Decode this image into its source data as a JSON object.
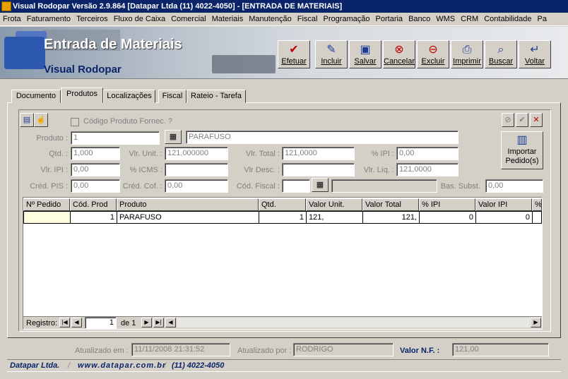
{
  "window": {
    "title": "Visual Rodopar Versão 2.9.864 [Datapar Ltda (11) 4022-4050]  - [ENTRADA DE MATERIAIS]"
  },
  "menu": [
    "Frota",
    "Faturamento",
    "Terceiros",
    "Fluxo de Caixa",
    "Comercial",
    "Materiais",
    "Manutenção",
    "Fiscal",
    "Programação",
    "Portaria",
    "Banco",
    "WMS",
    "CRM",
    "Contabilidade",
    "Pa"
  ],
  "banner": {
    "title": "Entrada de Materiais",
    "subtitle": "Visual Rodopar"
  },
  "toolbar": [
    {
      "label": "Efetuar",
      "icon": "check-icon"
    },
    {
      "label": "Incluir",
      "icon": "include-icon"
    },
    {
      "label": "Salvar",
      "icon": "save-icon"
    },
    {
      "label": "Cancelar",
      "icon": "cancel-icon"
    },
    {
      "label": "Excluir",
      "icon": "delete-icon"
    },
    {
      "label": "Imprimir",
      "icon": "print-icon"
    },
    {
      "label": "Buscar",
      "icon": "search-icon"
    },
    {
      "label": "Voltar",
      "icon": "back-icon"
    }
  ],
  "tabs": [
    "Documento",
    "Produtos",
    "Localizações",
    "Fiscal",
    "Rateio - Tarefa"
  ],
  "active_tab": "Produtos",
  "form": {
    "codigo_fornec_label": "Código Produto Fornec. ?",
    "produto_label": "Produto :",
    "produto_code": "1",
    "produto_desc": "PARAFUSO",
    "qtd_label": "Qtd. :",
    "qtd": "1,000",
    "vlr_unit_label": "Vlr. Unit. :",
    "vlr_unit": "121,000000",
    "vlr_total_label": "Vlr. Total :",
    "vlr_total": "121,0000",
    "pct_ipi_label": "% IPI :",
    "pct_ipi": "0,00",
    "vlr_ipi_label": "Vlr. IPI :",
    "vlr_ipi": "0,00",
    "pct_icms_label": "% ICMS :",
    "pct_icms": "",
    "vlr_desc_label": "Vlr Desc. :",
    "vlr_desc": "",
    "vlr_liq_label": "Vlr. Líq. :",
    "vlr_liq": "121,0000",
    "cred_pis_label": "Créd. PIS :",
    "cred_pis": "0,00",
    "cred_cof_label": "Créd. Cof. :",
    "cred_cof": "0,00",
    "cod_fiscal_label": "Cód. Fiscal :",
    "cod_fiscal": "",
    "bas_subst_label": "Bas. Subst.",
    "bas_subst": "0,00",
    "importar_label": "Importar Pedido(s)"
  },
  "grid": {
    "columns": [
      "Nº Pedido",
      "Cód. Prod",
      "Produto",
      "Qtd.",
      "Valor Unit.",
      "Valor Total",
      "% IPI",
      "Valor IPI",
      "%"
    ],
    "rows": [
      [
        "",
        "1",
        "PARAFUSO",
        "1",
        "121,",
        "121,",
        "0",
        "0",
        ""
      ]
    ],
    "registro_label": "Registro:",
    "registro_value": "1",
    "registro_total": "de 1"
  },
  "footer": {
    "atualizado_em_label": "Atualizado em :",
    "atualizado_em": "11/11/2008 21:31:52",
    "atualizado_por_label": "Atualizado por :",
    "atualizado_por": "RODRIGO",
    "valor_nf_label": "Valor N.F. :",
    "valor_nf": "121,00"
  },
  "status": {
    "company": "Datapar Ltda.",
    "site": "www.datapar.com.br",
    "phone": "(11) 4022-4050"
  }
}
